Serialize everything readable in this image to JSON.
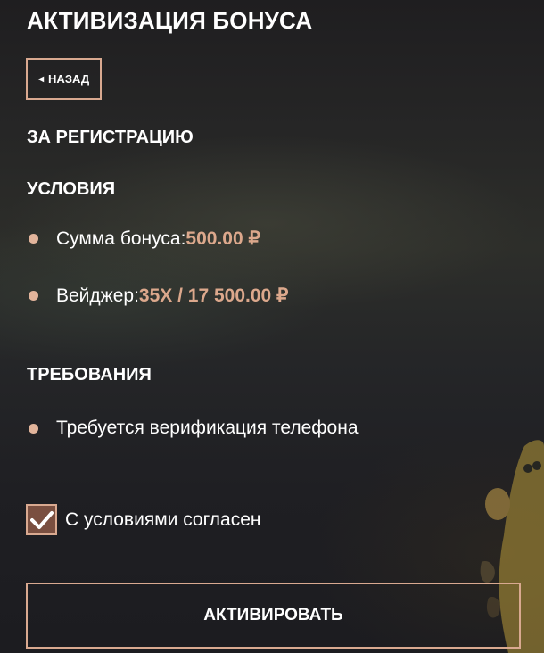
{
  "page": {
    "title": "АКТИВИЗАЦИЯ БОНУСА"
  },
  "back_button": {
    "label": "НАЗАД",
    "icon": "chevron-left-icon"
  },
  "bonus": {
    "name": "ЗА РЕГИСТРАЦИЮ"
  },
  "conditions": {
    "heading": "УСЛОВИЯ",
    "items": [
      {
        "label": "Сумма бонуса: ",
        "value": "500.00 ₽"
      },
      {
        "label": "Вейджер: ",
        "value": "35X / 17 500.00 ₽"
      }
    ]
  },
  "requirements": {
    "heading": "ТРЕБОВАНИЯ",
    "items": [
      {
        "label": "Требуется верификация телефона"
      }
    ]
  },
  "agreement": {
    "label": "С условиями согласен",
    "checked": true,
    "icon": "checkmark-icon"
  },
  "activate_button": {
    "label": "АКТИВИРОВАТЬ"
  },
  "colors": {
    "accent": "#dca88c",
    "border": "#d9a990",
    "checkbox_fill": "#7a4f40",
    "text": "#ffffff"
  }
}
